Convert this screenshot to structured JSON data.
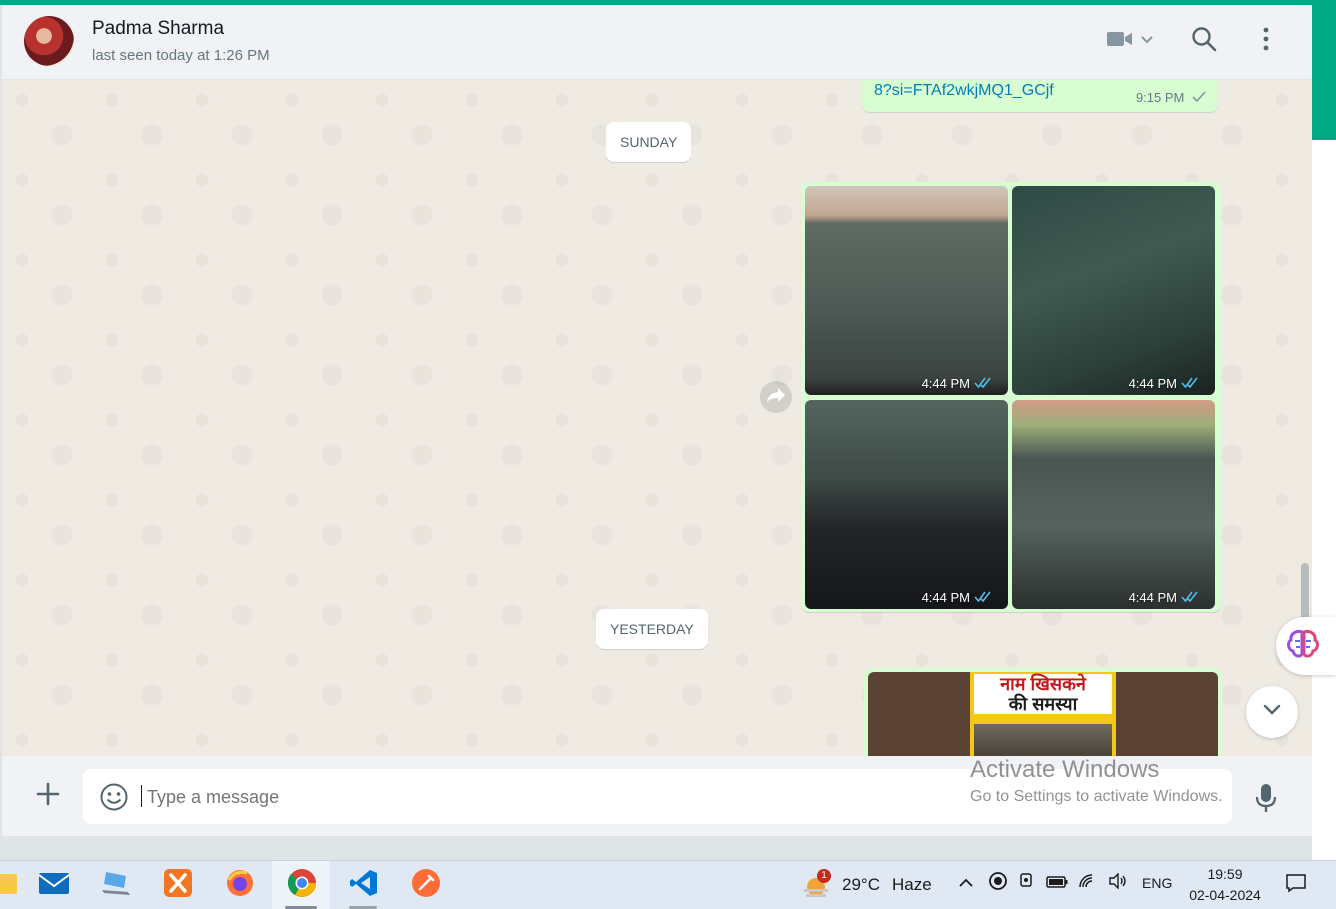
{
  "contact": {
    "name": "Padma Sharma",
    "status": "last seen today at 1:26 PM"
  },
  "messages": {
    "link_fragment": "8?si=FTAf2wkjMQ1_GCjf",
    "link_time": "9:15 PM",
    "day_sunday": "SUNDAY",
    "photos": [
      {
        "time": "4:44 PM"
      },
      {
        "time": "4:44 PM"
      },
      {
        "time": "4:44 PM"
      },
      {
        "time": "4:44 PM"
      }
    ],
    "day_yesterday": "YESTERDAY",
    "poster_line1": "नाम खिसकने",
    "poster_line2": "की समस्या"
  },
  "composer": {
    "placeholder": "Type a message"
  },
  "watermark": {
    "title": "Activate Windows",
    "subtitle": "Go to Settings to activate Windows."
  },
  "taskbar": {
    "weather_badge": "1",
    "weather_temp": "29°C",
    "weather_desc": "Haze",
    "language": "ENG",
    "time": "19:59",
    "date": "02-04-2024"
  },
  "colors": {
    "accent": "#00a884",
    "outgoing_bubble": "#d9fdd3",
    "read_tick": "#53bdeb",
    "chat_bg": "#efeae2"
  },
  "icons": [
    "video-call-icon",
    "search-icon",
    "menu-icon",
    "forward-icon",
    "chevron-down-icon",
    "plus-icon",
    "emoji-icon",
    "mic-icon"
  ]
}
